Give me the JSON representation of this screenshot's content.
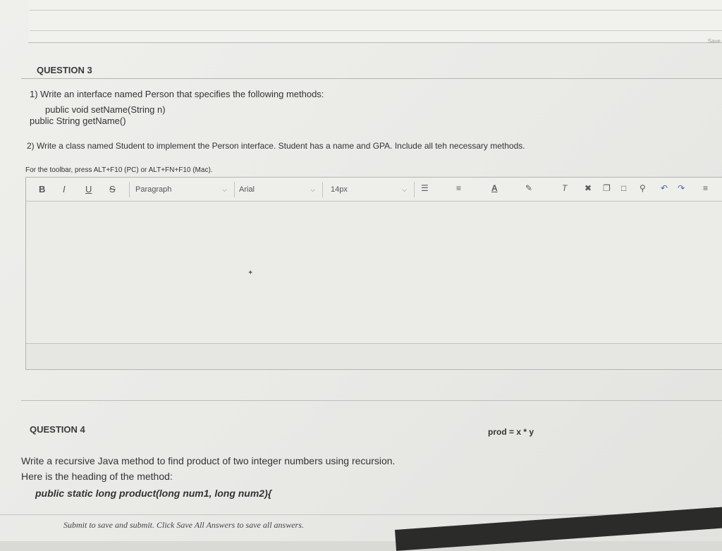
{
  "corner_label": "Save",
  "q3": {
    "header": "QUESTION 3",
    "line1": "1) Write an interface named Person that specifies the following methods:",
    "line2": "public void setName(String n)",
    "line3": "public String getName()",
    "line4": "2) Write a class named Student to implement the Person interface. Student has a name and GPA. Include all teh necessary methods."
  },
  "editor": {
    "hint": "For the toolbar, press ALT+F10 (PC) or ALT+FN+F10 (Mac).",
    "bold": "B",
    "italic": "I",
    "underline": "U",
    "strike": "S",
    "paragraph": "Paragraph",
    "font": "Arial",
    "size": "14px",
    "content": ""
  },
  "q4": {
    "header": "QUESTION 4",
    "line1": "Write a recursive Java method to find product of two integer numbers using recursion.",
    "formula": "prod = x * y",
    "line2": "Here is the heading of the method:",
    "line3": "public static long product(long num1, long num2){"
  },
  "footer": "Click Save All Answers to save all answers.",
  "footer_prefix": "Submit to save and submit."
}
